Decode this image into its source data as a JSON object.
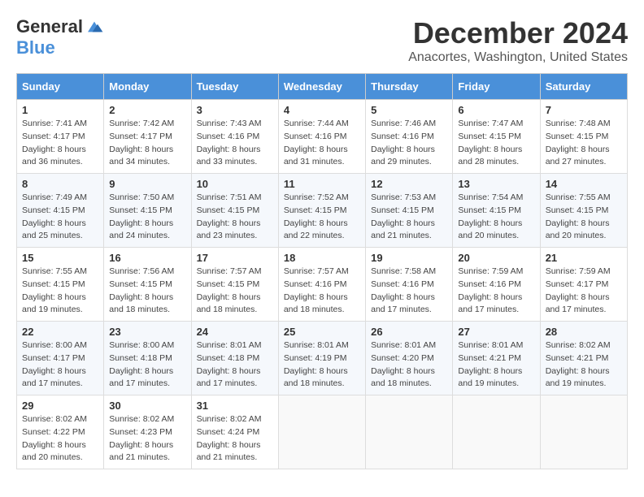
{
  "logo": {
    "general": "General",
    "blue": "Blue"
  },
  "title": "December 2024",
  "location": "Anacortes, Washington, United States",
  "days_of_week": [
    "Sunday",
    "Monday",
    "Tuesday",
    "Wednesday",
    "Thursday",
    "Friday",
    "Saturday"
  ],
  "weeks": [
    [
      {
        "day": "1",
        "sunrise": "Sunrise: 7:41 AM",
        "sunset": "Sunset: 4:17 PM",
        "daylight": "Daylight: 8 hours and 36 minutes."
      },
      {
        "day": "2",
        "sunrise": "Sunrise: 7:42 AM",
        "sunset": "Sunset: 4:17 PM",
        "daylight": "Daylight: 8 hours and 34 minutes."
      },
      {
        "day": "3",
        "sunrise": "Sunrise: 7:43 AM",
        "sunset": "Sunset: 4:16 PM",
        "daylight": "Daylight: 8 hours and 33 minutes."
      },
      {
        "day": "4",
        "sunrise": "Sunrise: 7:44 AM",
        "sunset": "Sunset: 4:16 PM",
        "daylight": "Daylight: 8 hours and 31 minutes."
      },
      {
        "day": "5",
        "sunrise": "Sunrise: 7:46 AM",
        "sunset": "Sunset: 4:16 PM",
        "daylight": "Daylight: 8 hours and 29 minutes."
      },
      {
        "day": "6",
        "sunrise": "Sunrise: 7:47 AM",
        "sunset": "Sunset: 4:15 PM",
        "daylight": "Daylight: 8 hours and 28 minutes."
      },
      {
        "day": "7",
        "sunrise": "Sunrise: 7:48 AM",
        "sunset": "Sunset: 4:15 PM",
        "daylight": "Daylight: 8 hours and 27 minutes."
      }
    ],
    [
      {
        "day": "8",
        "sunrise": "Sunrise: 7:49 AM",
        "sunset": "Sunset: 4:15 PM",
        "daylight": "Daylight: 8 hours and 25 minutes."
      },
      {
        "day": "9",
        "sunrise": "Sunrise: 7:50 AM",
        "sunset": "Sunset: 4:15 PM",
        "daylight": "Daylight: 8 hours and 24 minutes."
      },
      {
        "day": "10",
        "sunrise": "Sunrise: 7:51 AM",
        "sunset": "Sunset: 4:15 PM",
        "daylight": "Daylight: 8 hours and 23 minutes."
      },
      {
        "day": "11",
        "sunrise": "Sunrise: 7:52 AM",
        "sunset": "Sunset: 4:15 PM",
        "daylight": "Daylight: 8 hours and 22 minutes."
      },
      {
        "day": "12",
        "sunrise": "Sunrise: 7:53 AM",
        "sunset": "Sunset: 4:15 PM",
        "daylight": "Daylight: 8 hours and 21 minutes."
      },
      {
        "day": "13",
        "sunrise": "Sunrise: 7:54 AM",
        "sunset": "Sunset: 4:15 PM",
        "daylight": "Daylight: 8 hours and 20 minutes."
      },
      {
        "day": "14",
        "sunrise": "Sunrise: 7:55 AM",
        "sunset": "Sunset: 4:15 PM",
        "daylight": "Daylight: 8 hours and 20 minutes."
      }
    ],
    [
      {
        "day": "15",
        "sunrise": "Sunrise: 7:55 AM",
        "sunset": "Sunset: 4:15 PM",
        "daylight": "Daylight: 8 hours and 19 minutes."
      },
      {
        "day": "16",
        "sunrise": "Sunrise: 7:56 AM",
        "sunset": "Sunset: 4:15 PM",
        "daylight": "Daylight: 8 hours and 18 minutes."
      },
      {
        "day": "17",
        "sunrise": "Sunrise: 7:57 AM",
        "sunset": "Sunset: 4:15 PM",
        "daylight": "Daylight: 8 hours and 18 minutes."
      },
      {
        "day": "18",
        "sunrise": "Sunrise: 7:57 AM",
        "sunset": "Sunset: 4:16 PM",
        "daylight": "Daylight: 8 hours and 18 minutes."
      },
      {
        "day": "19",
        "sunrise": "Sunrise: 7:58 AM",
        "sunset": "Sunset: 4:16 PM",
        "daylight": "Daylight: 8 hours and 17 minutes."
      },
      {
        "day": "20",
        "sunrise": "Sunrise: 7:59 AM",
        "sunset": "Sunset: 4:16 PM",
        "daylight": "Daylight: 8 hours and 17 minutes."
      },
      {
        "day": "21",
        "sunrise": "Sunrise: 7:59 AM",
        "sunset": "Sunset: 4:17 PM",
        "daylight": "Daylight: 8 hours and 17 minutes."
      }
    ],
    [
      {
        "day": "22",
        "sunrise": "Sunrise: 8:00 AM",
        "sunset": "Sunset: 4:17 PM",
        "daylight": "Daylight: 8 hours and 17 minutes."
      },
      {
        "day": "23",
        "sunrise": "Sunrise: 8:00 AM",
        "sunset": "Sunset: 4:18 PM",
        "daylight": "Daylight: 8 hours and 17 minutes."
      },
      {
        "day": "24",
        "sunrise": "Sunrise: 8:01 AM",
        "sunset": "Sunset: 4:18 PM",
        "daylight": "Daylight: 8 hours and 17 minutes."
      },
      {
        "day": "25",
        "sunrise": "Sunrise: 8:01 AM",
        "sunset": "Sunset: 4:19 PM",
        "daylight": "Daylight: 8 hours and 18 minutes."
      },
      {
        "day": "26",
        "sunrise": "Sunrise: 8:01 AM",
        "sunset": "Sunset: 4:20 PM",
        "daylight": "Daylight: 8 hours and 18 minutes."
      },
      {
        "day": "27",
        "sunrise": "Sunrise: 8:01 AM",
        "sunset": "Sunset: 4:21 PM",
        "daylight": "Daylight: 8 hours and 19 minutes."
      },
      {
        "day": "28",
        "sunrise": "Sunrise: 8:02 AM",
        "sunset": "Sunset: 4:21 PM",
        "daylight": "Daylight: 8 hours and 19 minutes."
      }
    ],
    [
      {
        "day": "29",
        "sunrise": "Sunrise: 8:02 AM",
        "sunset": "Sunset: 4:22 PM",
        "daylight": "Daylight: 8 hours and 20 minutes."
      },
      {
        "day": "30",
        "sunrise": "Sunrise: 8:02 AM",
        "sunset": "Sunset: 4:23 PM",
        "daylight": "Daylight: 8 hours and 21 minutes."
      },
      {
        "day": "31",
        "sunrise": "Sunrise: 8:02 AM",
        "sunset": "Sunset: 4:24 PM",
        "daylight": "Daylight: 8 hours and 21 minutes."
      },
      null,
      null,
      null,
      null
    ]
  ]
}
